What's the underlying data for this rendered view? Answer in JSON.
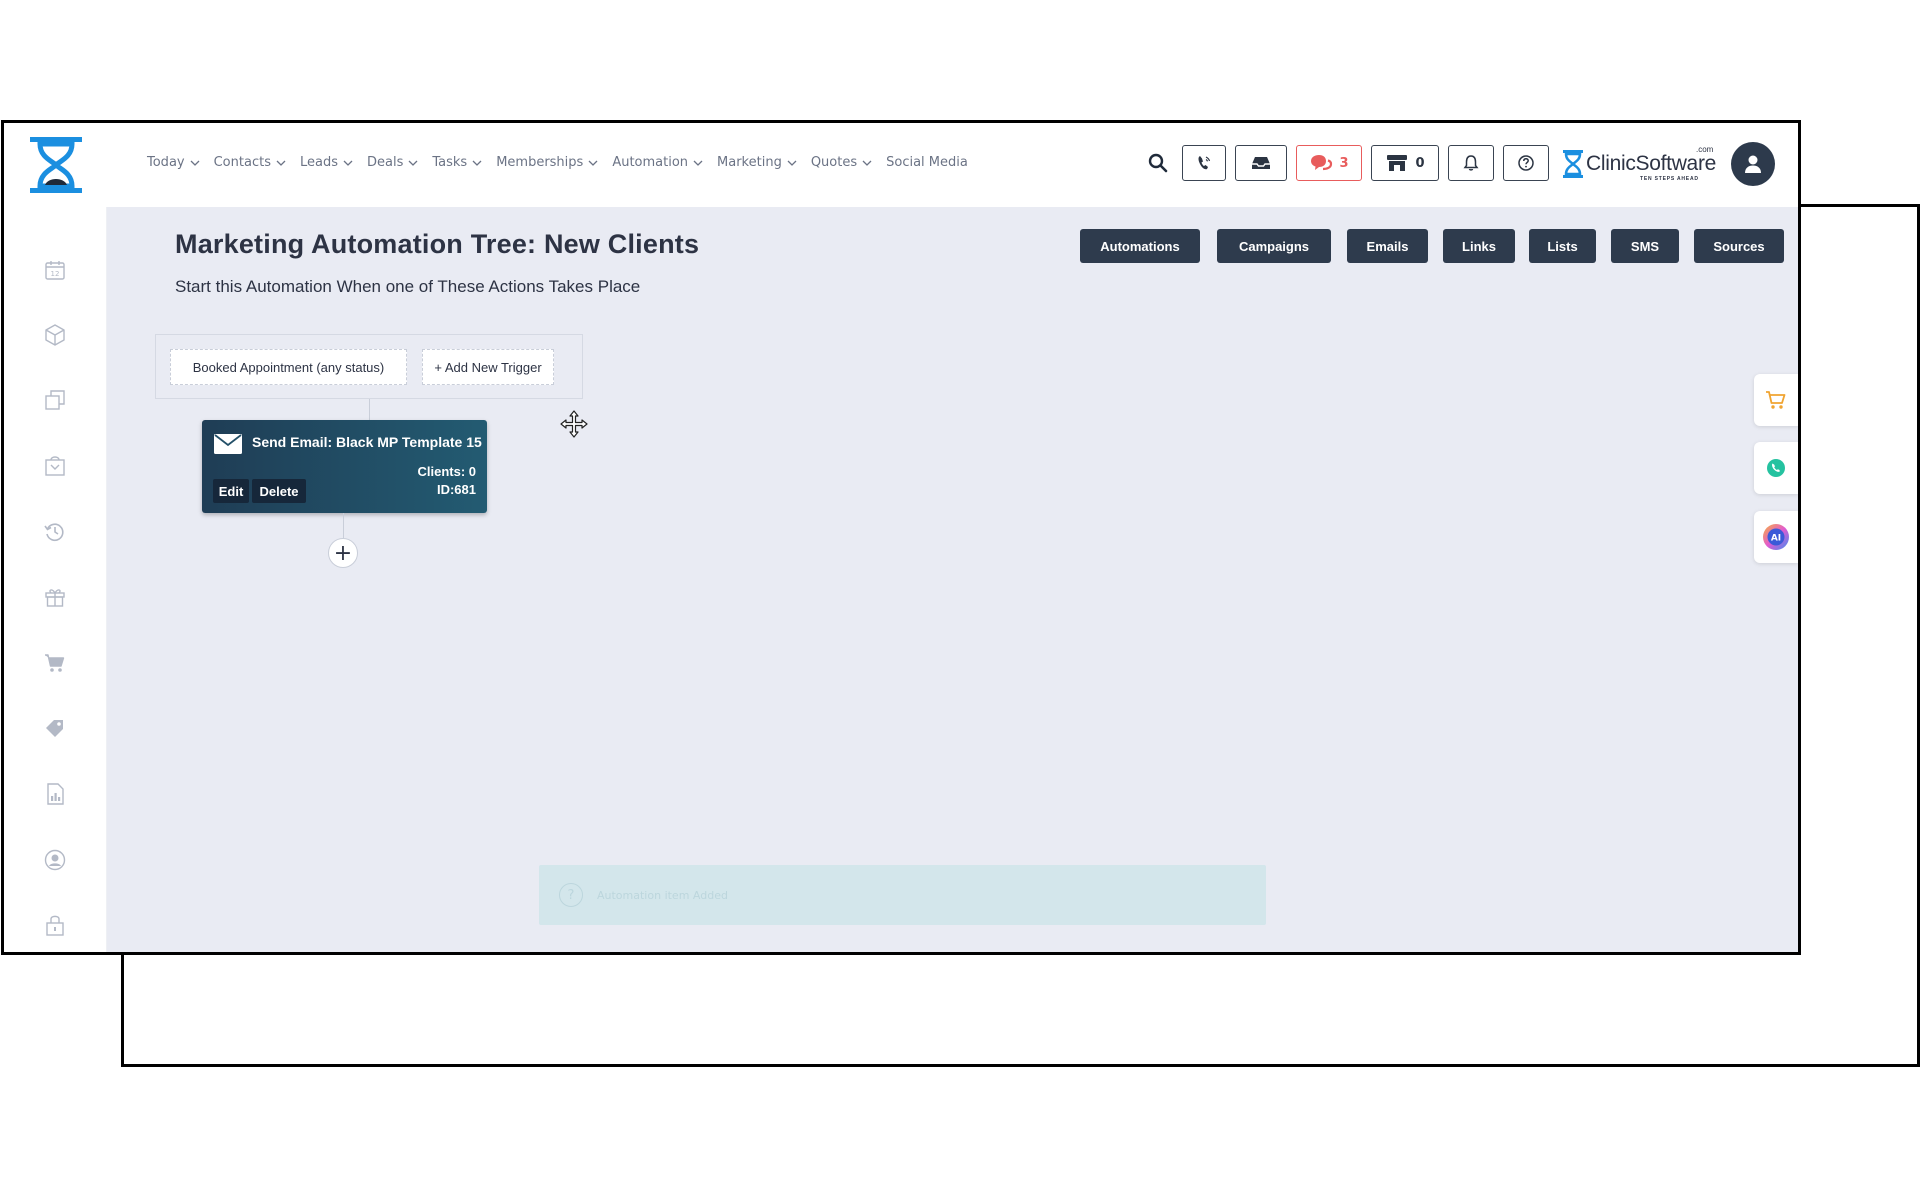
{
  "nav": [
    {
      "label": "Today",
      "has_menu": true
    },
    {
      "label": "Contacts",
      "has_menu": true
    },
    {
      "label": "Leads",
      "has_menu": true
    },
    {
      "label": "Deals",
      "has_menu": true
    },
    {
      "label": "Tasks",
      "has_menu": true
    },
    {
      "label": "Memberships",
      "has_menu": true
    },
    {
      "label": "Automation",
      "has_menu": true
    },
    {
      "label": "Marketing",
      "has_menu": true
    },
    {
      "label": "Quotes",
      "has_menu": true
    },
    {
      "label": "Social Media",
      "has_menu": false
    }
  ],
  "toolbar": {
    "messages_count": "3",
    "store_count": "0",
    "brand_name": "ClinicSoftware",
    "brand_suffix": ".com",
    "brand_tagline": "TEN STEPS AHEAD"
  },
  "sidebar_icons": [
    "calendar-icon",
    "box-icon",
    "copy-icon",
    "basket-icon",
    "history-icon",
    "gift-icon",
    "cart-icon",
    "tag-icon",
    "report-icon",
    "user-circle-icon",
    "lock-icon"
  ],
  "page": {
    "title": "Marketing Automation Tree: New Clients",
    "subtitle": "Start this Automation When one of These Actions Takes Place"
  },
  "top_buttons": [
    "Automations",
    "Campaigns",
    "Emails",
    "Links",
    "Lists",
    "SMS",
    "Sources"
  ],
  "triggers": {
    "booked": "Booked Appointment (any status)",
    "add_new": "+ Add New Trigger"
  },
  "node": {
    "title": "Send Email: Black MP Template 15",
    "clients": "Clients: 0",
    "id": "ID:681",
    "edit_label": "Edit",
    "delete_label": "Delete",
    "add_label": "+"
  },
  "toast": {
    "message": "Automation item Added",
    "icon": "?"
  },
  "colors": {
    "primary": "#2e3b4d",
    "accent_red": "#e85c5c",
    "canvas": "#e9ebf3",
    "node_start": "#1f3d55",
    "node_end": "#235b72"
  }
}
